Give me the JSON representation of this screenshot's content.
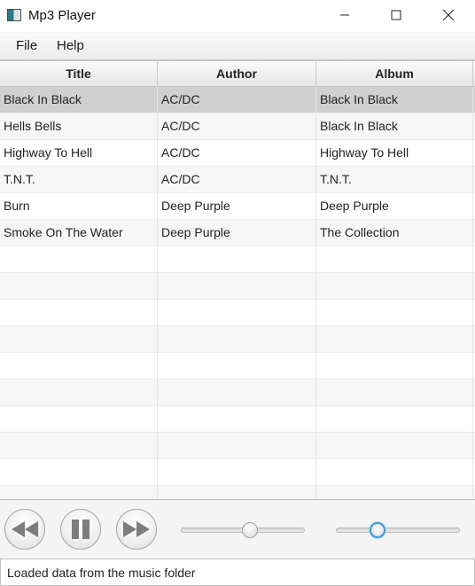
{
  "window": {
    "title": "Mp3 Player",
    "icon": "app-icon"
  },
  "titlebar_buttons": [
    "minimize-icon",
    "maximize-icon",
    "close-icon"
  ],
  "menu": {
    "items": [
      {
        "label": "File"
      },
      {
        "label": "Help"
      }
    ]
  },
  "table": {
    "columns": [
      "Title",
      "Author",
      "Album"
    ],
    "rows": [
      {
        "title": "Black In Black",
        "author": "AC/DC",
        "album": "Black In Black",
        "selected": true
      },
      {
        "title": "Hells Bells",
        "author": "AC/DC",
        "album": "Black In Black",
        "selected": false
      },
      {
        "title": "Highway To Hell",
        "author": "AC/DC",
        "album": "Highway To Hell",
        "selected": false
      },
      {
        "title": "T.N.T.",
        "author": "AC/DC",
        "album": "T.N.T.",
        "selected": false
      },
      {
        "title": "Burn",
        "author": "Deep Purple",
        "album": "Deep Purple",
        "selected": false
      },
      {
        "title": "Smoke On The Water",
        "author": "Deep Purple",
        "album": "The Collection",
        "selected": false
      }
    ],
    "empty_rows": 10
  },
  "player": {
    "buttons": [
      "rewind-icon",
      "pause-icon",
      "fast-forward-icon"
    ],
    "progress_level": 0.56,
    "volume_level": 0.3,
    "accent_color": "#3c9bd6"
  },
  "status": {
    "text": "Loaded data from the music folder"
  }
}
